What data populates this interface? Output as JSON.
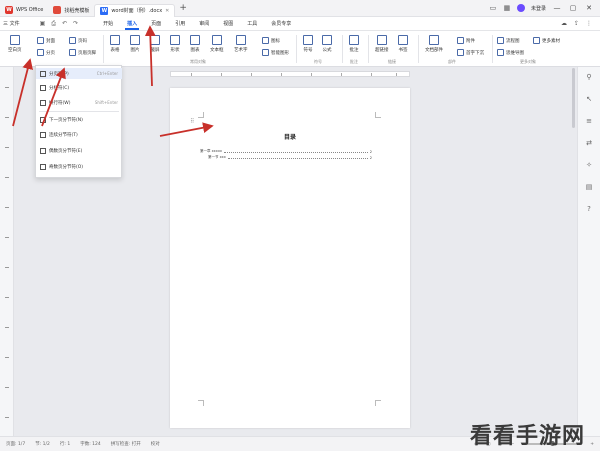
{
  "titlebar": {
    "app_tab": "WPS Office",
    "templates_tab": "找稻壳模板",
    "doc_tab": "word封面（例）.docx",
    "plus": "+",
    "login": "未登录",
    "minimize": "—",
    "maximize": "▢",
    "close": "✕"
  },
  "menubar": {
    "file": "三 文件",
    "items": [
      "开始",
      "插入",
      "页面",
      "引用",
      "审阅",
      "视图",
      "工具",
      "会员专享"
    ],
    "active": "插入"
  },
  "ribbon": {
    "blank_page": "空白页",
    "cover": "封面",
    "page_break": "分页",
    "page_num": "页码",
    "header_footer": "页眉页脚",
    "table": "表格",
    "picture": "图片",
    "screenshot": "截屏",
    "shape": "形状",
    "icon": "图标",
    "chart": "图表",
    "smart": "智能图形",
    "textbox": "文本框",
    "wordart": "艺术字",
    "symbol": "符号",
    "formula": "公式",
    "comment": "批注",
    "hyperlink": "超链接",
    "bookmark": "书签",
    "doc_parts": "文档部件",
    "attach": "附件",
    "first_drop": "首字下沉",
    "flow": "流程图",
    "mind": "思维导图",
    "more": "更多素材",
    "grp_common": "常用对象",
    "grp_symbol": "符号",
    "grp_comment": "批注",
    "grp_link": "链接",
    "grp_parts": "部件",
    "grp_more": "更多对象"
  },
  "dropdown": {
    "items": [
      {
        "label": "分页符(P)",
        "shortcut": "Ctrl+Enter"
      },
      {
        "label": "分栏符(C)",
        "shortcut": ""
      },
      {
        "label": "换行符(W)",
        "shortcut": "Shift+Enter"
      },
      {
        "label": "下一页分节符(N)",
        "shortcut": ""
      },
      {
        "label": "连续分节符(T)",
        "shortcut": ""
      },
      {
        "label": "偶数页分节符(E)",
        "shortcut": ""
      },
      {
        "label": "奇数页分节符(O)",
        "shortcut": ""
      }
    ]
  },
  "document": {
    "toc_title": "目录",
    "toc": [
      {
        "label": "第一章 xxxxx",
        "page": "2"
      },
      {
        "label": "第一节 xxx",
        "page": "2"
      }
    ]
  },
  "statusbar": {
    "page": "页面: 1/7",
    "section": "节: 1/2",
    "row": "行: 1",
    "words": "字数: 124",
    "spell": "拼写检查: 打开",
    "proof": "校对"
  },
  "watermark": "看看手游网",
  "colors": {
    "accent": "#1a62e8",
    "arrow": "#c8302a"
  }
}
